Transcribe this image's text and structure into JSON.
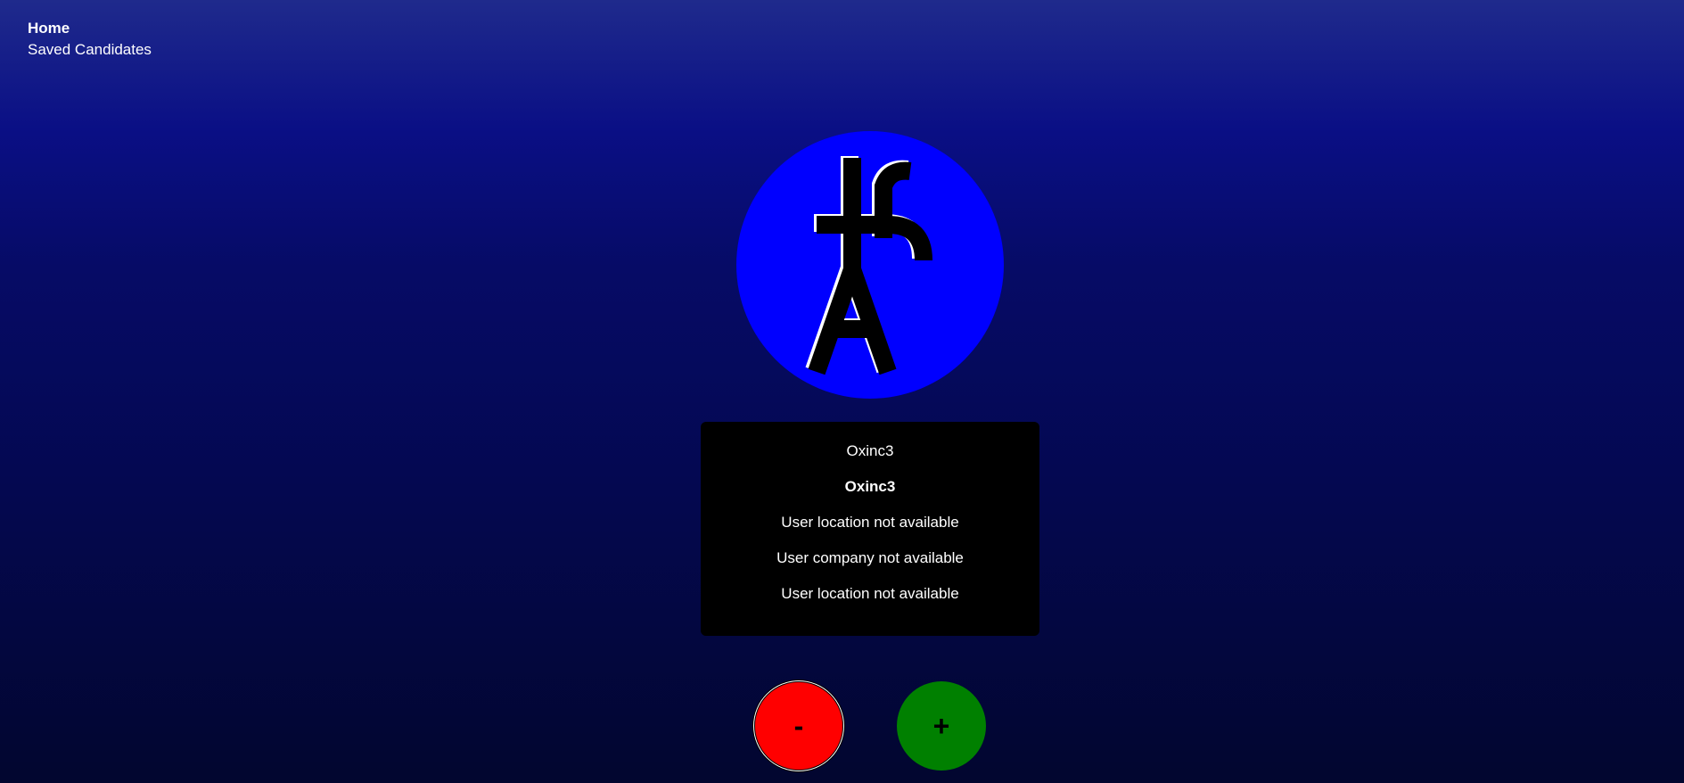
{
  "nav": {
    "home": "Home",
    "saved_candidates": "Saved Candidates"
  },
  "candidate": {
    "avatar_icon": "github-style-avatar-glyph",
    "login": "Oxinc3",
    "name": "Oxinc3",
    "location": "User location not available",
    "company": "User company not available",
    "location_repeat": "User location not available"
  },
  "actions": {
    "reject_label": "-",
    "accept_label": "+"
  },
  "colors": {
    "avatar_bg": "#0000ff",
    "card_bg": "#000000",
    "reject": "#ff0000",
    "accept": "#008000"
  }
}
